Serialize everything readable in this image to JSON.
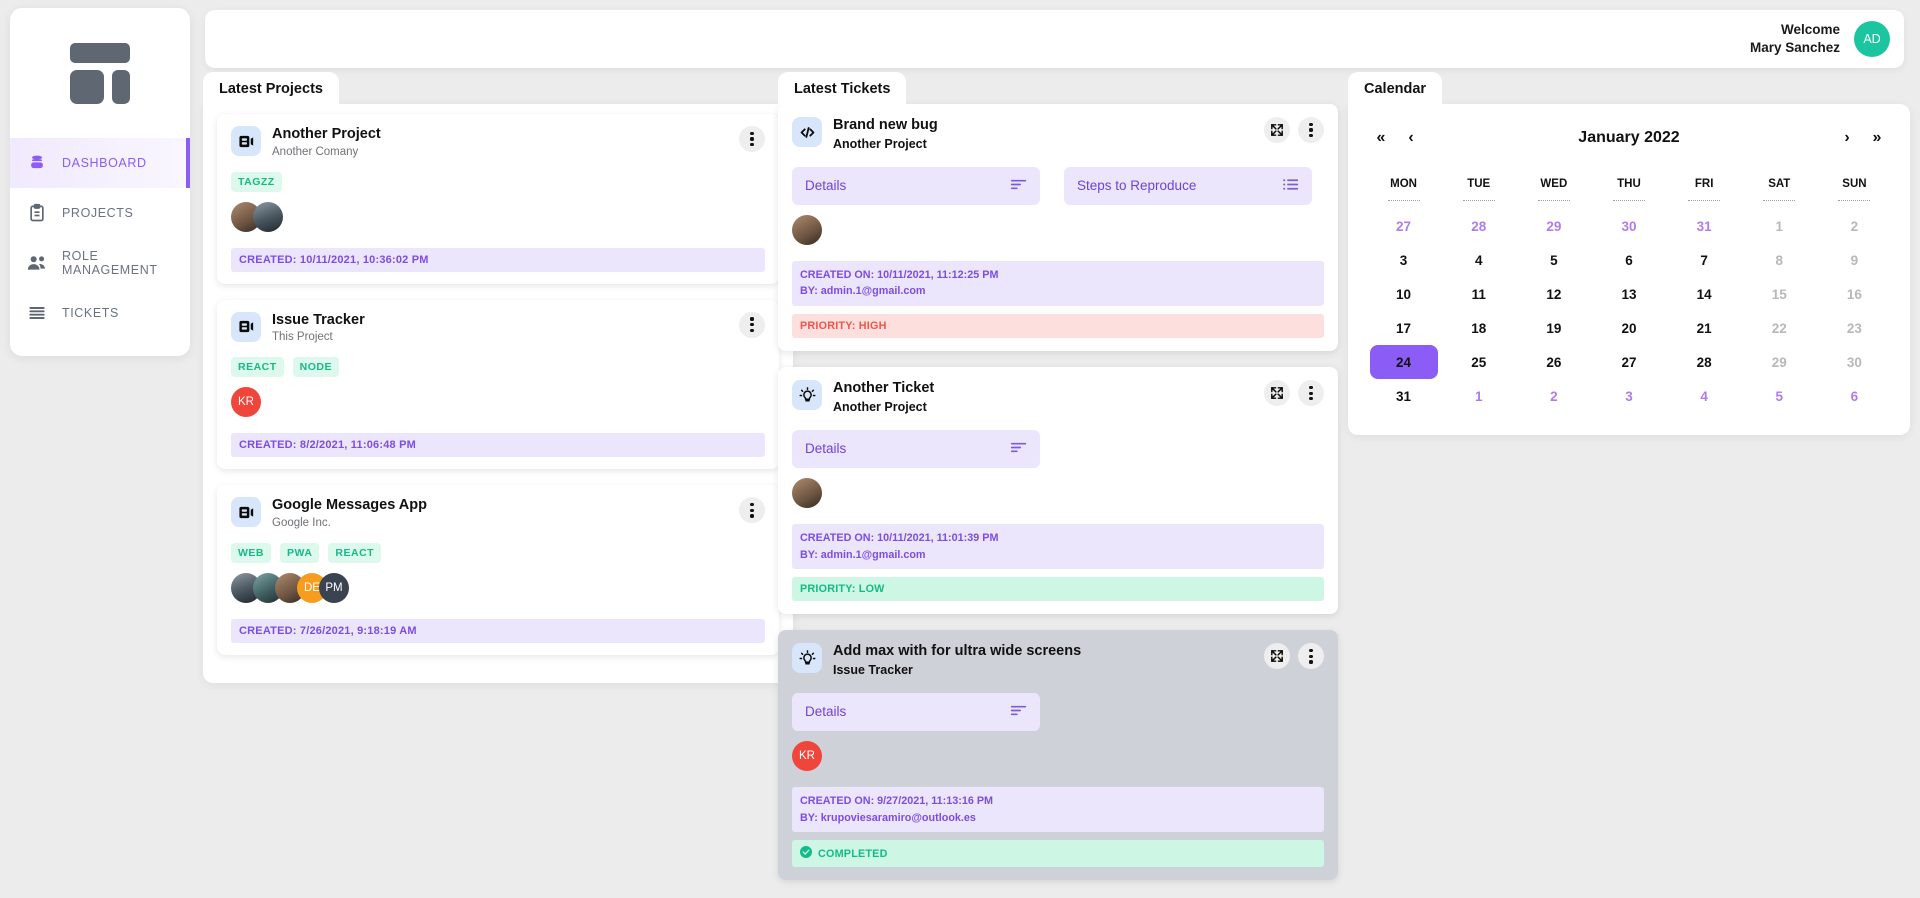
{
  "brand": {
    "logo_name": "dashboard-logo"
  },
  "sidebar": {
    "items": [
      {
        "label": "DASHBOARD",
        "icon": "database-icon",
        "active": true
      },
      {
        "label": "PROJECTS",
        "icon": "clipboard-icon",
        "active": false
      },
      {
        "label": "ROLE MANAGEMENT",
        "icon": "people-icon",
        "active": false
      },
      {
        "label": "TICKETS",
        "icon": "list-lines-icon",
        "active": false
      }
    ]
  },
  "topbar": {
    "welcome_line1": "Welcome",
    "welcome_line2": "Mary Sanchez",
    "avatar_initials": "AD",
    "avatar_color": "#1bc5a0"
  },
  "projects_panel": {
    "tab_label": "Latest Projects",
    "created_prefix": "CREATED:",
    "cards": [
      {
        "title": "Another Project",
        "subtitle": "Another Comany",
        "tags": [
          "TAGZZ"
        ],
        "members": [
          {
            "type": "photo",
            "style": "ph1"
          },
          {
            "type": "photo",
            "style": "ph3"
          }
        ],
        "created": "CREATED: 10/11/2021, 10:36:02 PM"
      },
      {
        "title": "Issue Tracker",
        "subtitle": "This Project",
        "tags": [
          "REACT",
          "NODE"
        ],
        "members": [
          {
            "type": "initials",
            "text": "KR",
            "style": "red"
          }
        ],
        "created": "CREATED: 8/2/2021, 11:06:48 PM"
      },
      {
        "title": "Google Messages App",
        "subtitle": "Google Inc.",
        "tags": [
          "WEB",
          "PWA",
          "REACT"
        ],
        "members": [
          {
            "type": "photo",
            "style": "ph3"
          },
          {
            "type": "photo",
            "style": "ph4"
          },
          {
            "type": "photo",
            "style": "ph1"
          },
          {
            "type": "initials",
            "text": "DE",
            "style": "orange"
          },
          {
            "type": "initials",
            "text": "PM",
            "style": "dark"
          }
        ],
        "created": "CREATED: 7/26/2021, 9:18:19 AM"
      }
    ]
  },
  "tickets_panel": {
    "tab_label": "Latest Tickets",
    "cards": [
      {
        "icon": "code-icon",
        "title": "Brand new bug",
        "project": "Another Project",
        "chips": [
          {
            "label": "Details",
            "icon": "align-left-icon"
          },
          {
            "label": "Steps to Reproduce",
            "icon": "bullet-list-icon"
          }
        ],
        "members": [
          {
            "type": "photo",
            "style": "ph1"
          }
        ],
        "created_on": "CREATED ON: 10/11/2021, 11:12:25 PM",
        "created_by": "BY: admin.1@gmail.com",
        "status_label": "PRIORITY: HIGH",
        "status_kind": "high",
        "highlighted": false
      },
      {
        "icon": "lightbulb-icon",
        "title": "Another Ticket",
        "project": "Another Project",
        "chips": [
          {
            "label": "Details",
            "icon": "align-left-icon"
          }
        ],
        "members": [
          {
            "type": "photo",
            "style": "ph1"
          }
        ],
        "created_on": "CREATED ON: 10/11/2021, 11:01:39 PM",
        "created_by": "BY: admin.1@gmail.com",
        "status_label": "PRIORITY: LOW",
        "status_kind": "low",
        "highlighted": false
      },
      {
        "icon": "lightbulb-icon",
        "title": "Add max with for ultra wide screens",
        "project": "Issue Tracker",
        "chips": [
          {
            "label": "Details",
            "icon": "align-left-icon"
          }
        ],
        "members": [
          {
            "type": "initials",
            "text": "KR",
            "style": "red"
          }
        ],
        "created_on": "CREATED ON: 9/27/2021, 11:13:16 PM",
        "created_by": "BY: krupoviesaramiro@outlook.es",
        "status_label": "COMPLETED",
        "status_kind": "done",
        "highlighted": true
      }
    ]
  },
  "calendar_panel": {
    "tab_label": "Calendar",
    "title": "January 2022",
    "nav": {
      "first": "«",
      "prev": "‹",
      "next": "›",
      "last": "»"
    },
    "dow": [
      "MON",
      "TUE",
      "WED",
      "THU",
      "FRI",
      "SAT",
      "SUN"
    ],
    "selected_day": 24,
    "accent": "#8b5cf6",
    "weeks": [
      [
        {
          "d": "27",
          "k": "adj"
        },
        {
          "d": "28",
          "k": "adj"
        },
        {
          "d": "29",
          "k": "adj"
        },
        {
          "d": "30",
          "k": "adj"
        },
        {
          "d": "31",
          "k": "adj"
        },
        {
          "d": "1",
          "k": "out"
        },
        {
          "d": "2",
          "k": "out"
        }
      ],
      [
        {
          "d": "3",
          "k": "in"
        },
        {
          "d": "4",
          "k": "in"
        },
        {
          "d": "5",
          "k": "in"
        },
        {
          "d": "6",
          "k": "in"
        },
        {
          "d": "7",
          "k": "in"
        },
        {
          "d": "8",
          "k": "out"
        },
        {
          "d": "9",
          "k": "out"
        }
      ],
      [
        {
          "d": "10",
          "k": "in"
        },
        {
          "d": "11",
          "k": "in"
        },
        {
          "d": "12",
          "k": "in"
        },
        {
          "d": "13",
          "k": "in"
        },
        {
          "d": "14",
          "k": "in"
        },
        {
          "d": "15",
          "k": "out"
        },
        {
          "d": "16",
          "k": "out"
        }
      ],
      [
        {
          "d": "17",
          "k": "in"
        },
        {
          "d": "18",
          "k": "in"
        },
        {
          "d": "19",
          "k": "in"
        },
        {
          "d": "20",
          "k": "in"
        },
        {
          "d": "21",
          "k": "in"
        },
        {
          "d": "22",
          "k": "out"
        },
        {
          "d": "23",
          "k": "out"
        }
      ],
      [
        {
          "d": "24",
          "k": "sel"
        },
        {
          "d": "25",
          "k": "in"
        },
        {
          "d": "26",
          "k": "in"
        },
        {
          "d": "27",
          "k": "in"
        },
        {
          "d": "28",
          "k": "in"
        },
        {
          "d": "29",
          "k": "out"
        },
        {
          "d": "30",
          "k": "out"
        }
      ],
      [
        {
          "d": "31",
          "k": "in"
        },
        {
          "d": "1",
          "k": "adj"
        },
        {
          "d": "2",
          "k": "adj"
        },
        {
          "d": "3",
          "k": "adj"
        },
        {
          "d": "4",
          "k": "adj"
        },
        {
          "d": "5",
          "k": "adj"
        },
        {
          "d": "6",
          "k": "adj"
        }
      ]
    ]
  }
}
